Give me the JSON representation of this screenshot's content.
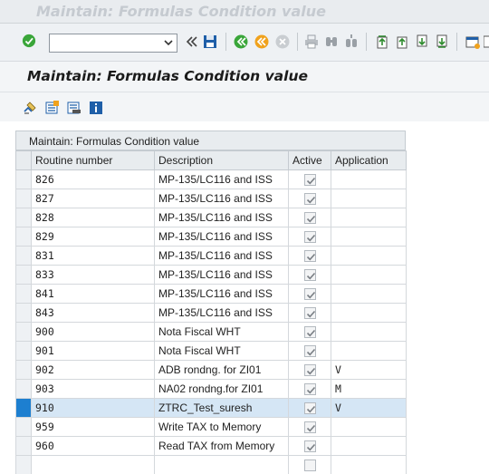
{
  "window": {
    "title_faded": "Maintain: Formulas Condition value"
  },
  "toolbar": {
    "command_value": ""
  },
  "header": {
    "title": "Maintain: Formulas Condition value"
  },
  "table": {
    "title": "Maintain: Formulas Condition value",
    "columns": [
      "Routine number",
      "Description",
      "Active",
      "Application"
    ],
    "rows": [
      {
        "routine": "826",
        "description": "MP-135/LC116 and ISS",
        "active": true,
        "application": "",
        "selected": false
      },
      {
        "routine": "827",
        "description": "MP-135/LC116 and ISS",
        "active": true,
        "application": "",
        "selected": false
      },
      {
        "routine": "828",
        "description": "MP-135/LC116 and ISS",
        "active": true,
        "application": "",
        "selected": false
      },
      {
        "routine": "829",
        "description": "MP-135/LC116 and ISS",
        "active": true,
        "application": "",
        "selected": false
      },
      {
        "routine": "831",
        "description": "MP-135/LC116 and ISS",
        "active": true,
        "application": "",
        "selected": false
      },
      {
        "routine": "833",
        "description": "MP-135/LC116 and ISS",
        "active": true,
        "application": "",
        "selected": false
      },
      {
        "routine": "841",
        "description": "MP-135/LC116 and ISS",
        "active": true,
        "application": "",
        "selected": false
      },
      {
        "routine": "843",
        "description": "MP-135/LC116 and ISS",
        "active": true,
        "application": "",
        "selected": false
      },
      {
        "routine": "900",
        "description": "Nota Fiscal WHT",
        "active": true,
        "application": "",
        "selected": false
      },
      {
        "routine": "901",
        "description": "Nota Fiscal WHT",
        "active": true,
        "application": "",
        "selected": false
      },
      {
        "routine": "902",
        "description": "ADB rondng. for ZI01",
        "active": true,
        "application": "V",
        "selected": false
      },
      {
        "routine": "903",
        "description": "NA02 rondng.for ZI01",
        "active": true,
        "application": "M",
        "selected": false
      },
      {
        "routine": "910",
        "description": "ZTRC_Test_suresh",
        "active": true,
        "application": "V",
        "selected": true
      },
      {
        "routine": "959",
        "description": "Write TAX to Memory",
        "active": true,
        "application": "",
        "selected": false
      },
      {
        "routine": "960",
        "description": "Read TAX from Memory",
        "active": true,
        "application": "",
        "selected": false
      },
      {
        "routine": "",
        "description": "",
        "active": false,
        "application": "",
        "selected": false
      }
    ]
  },
  "colors": {
    "selection": "#1d7fd0",
    "selected_row": "#d5e6f5",
    "check": "#7a7f85",
    "enter_green": "#3aa63a"
  }
}
